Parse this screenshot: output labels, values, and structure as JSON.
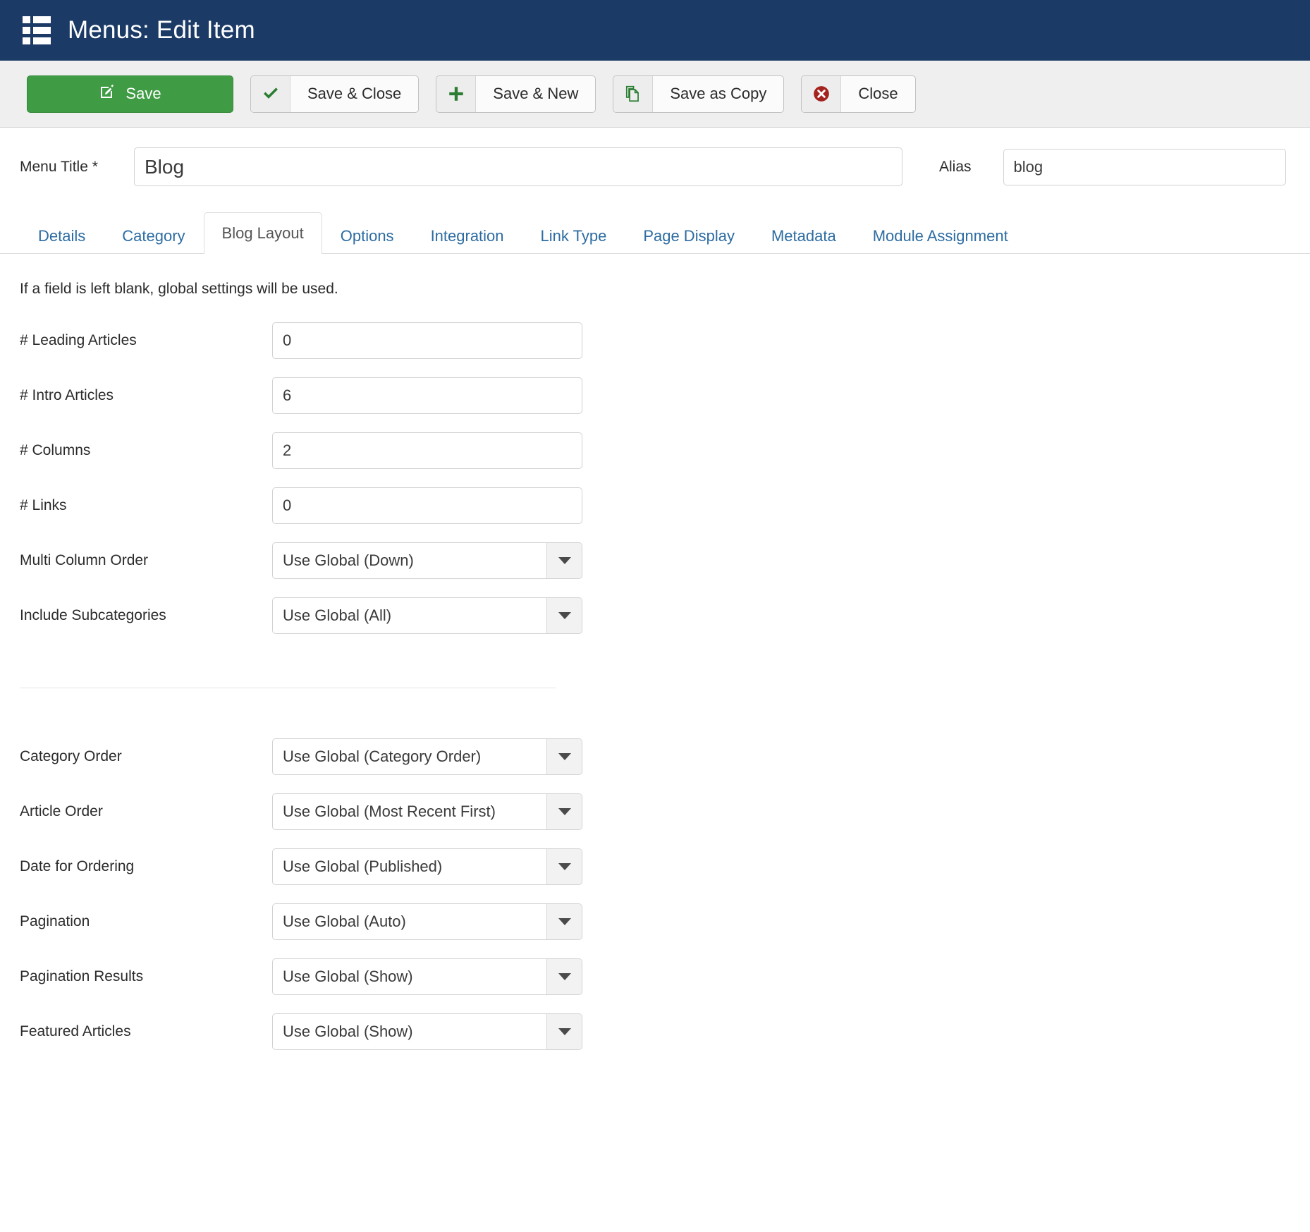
{
  "header": {
    "title": "Menus: Edit Item",
    "icon": "menu-list-icon",
    "bg_color": "#1b3a66"
  },
  "toolbar": {
    "save": {
      "label": "Save",
      "icon": "edit-pencil-icon",
      "color": "#3f9c45"
    },
    "save_close": {
      "label": "Save & Close",
      "icon": "check-icon",
      "icon_color": "#2a7d32"
    },
    "save_new": {
      "label": "Save & New",
      "icon": "plus-icon",
      "icon_color": "#2a7d32"
    },
    "save_copy": {
      "label": "Save as Copy",
      "icon": "copy-icon",
      "icon_color": "#2a7d32"
    },
    "close": {
      "label": "Close",
      "icon": "close-circle-icon",
      "icon_color": "#a5231e"
    }
  },
  "title_row": {
    "menu_title_label": "Menu Title *",
    "menu_title_value": "Blog",
    "menu_title_placeholder": "",
    "alias_label": "Alias",
    "alias_value": "blog",
    "alias_placeholder": ""
  },
  "tabs": [
    {
      "label": "Details",
      "active": false
    },
    {
      "label": "Category",
      "active": false
    },
    {
      "label": "Blog Layout",
      "active": true
    },
    {
      "label": "Options",
      "active": false
    },
    {
      "label": "Integration",
      "active": false
    },
    {
      "label": "Link Type",
      "active": false
    },
    {
      "label": "Page Display",
      "active": false
    },
    {
      "label": "Metadata",
      "active": false
    },
    {
      "label": "Module Assignment",
      "active": false
    }
  ],
  "main": {
    "note": "If a field is left blank, global settings will be used.",
    "fields_top": [
      {
        "label": "# Leading Articles",
        "type": "text",
        "value": "0"
      },
      {
        "label": "# Intro Articles",
        "type": "text",
        "value": "6"
      },
      {
        "label": "# Columns",
        "type": "text",
        "value": "2"
      },
      {
        "label": "# Links",
        "type": "text",
        "value": "0"
      },
      {
        "label": "Multi Column Order",
        "type": "select",
        "value": "Use Global (Down)"
      },
      {
        "label": "Include Subcategories",
        "type": "select",
        "value": "Use Global (All)"
      }
    ],
    "fields_bottom": [
      {
        "label": "Category Order",
        "type": "select",
        "value": "Use Global (Category Order)"
      },
      {
        "label": "Article Order",
        "type": "select",
        "value": "Use Global (Most Recent First)"
      },
      {
        "label": "Date for Ordering",
        "type": "select",
        "value": "Use Global (Published)"
      },
      {
        "label": "Pagination",
        "type": "select",
        "value": "Use Global (Auto)"
      },
      {
        "label": "Pagination Results",
        "type": "select",
        "value": "Use Global (Show)"
      },
      {
        "label": "Featured Articles",
        "type": "select",
        "value": "Use Global (Show)"
      }
    ]
  }
}
